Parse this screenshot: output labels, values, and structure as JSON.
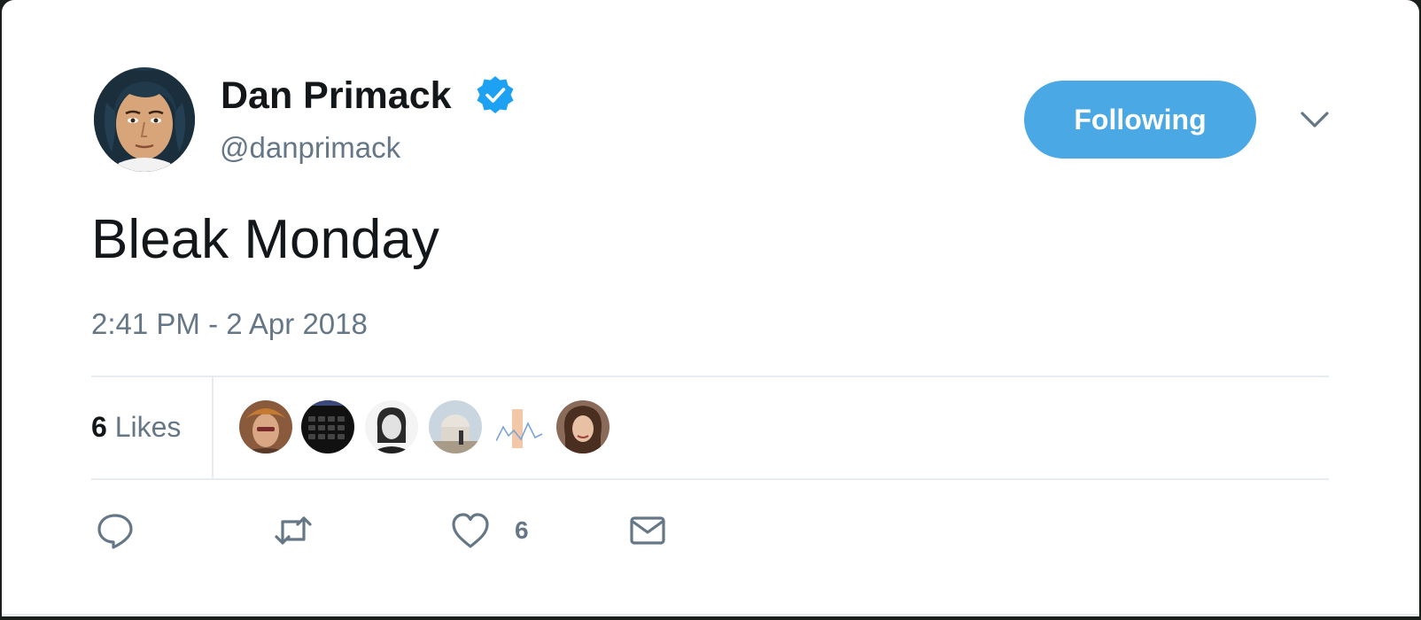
{
  "tweet": {
    "author": {
      "display_name": "Dan Primack",
      "handle": "@danprimack",
      "verified": true
    },
    "follow_button_label": "Following",
    "text": "Bleak Monday",
    "timestamp": "2:41 PM - 2 Apr 2018",
    "stats": {
      "likes_count": "6",
      "likes_label": "Likes"
    },
    "actions": {
      "reply_icon": "reply-icon",
      "retweet_icon": "retweet-icon",
      "like_icon": "heart-icon",
      "like_count": "6",
      "dm_icon": "envelope-icon"
    }
  },
  "colors": {
    "accent": "#4aa8e4",
    "verified": "#1da1f2",
    "text_primary": "#14171a",
    "text_secondary": "#657786",
    "divider": "#e6ecf0"
  }
}
